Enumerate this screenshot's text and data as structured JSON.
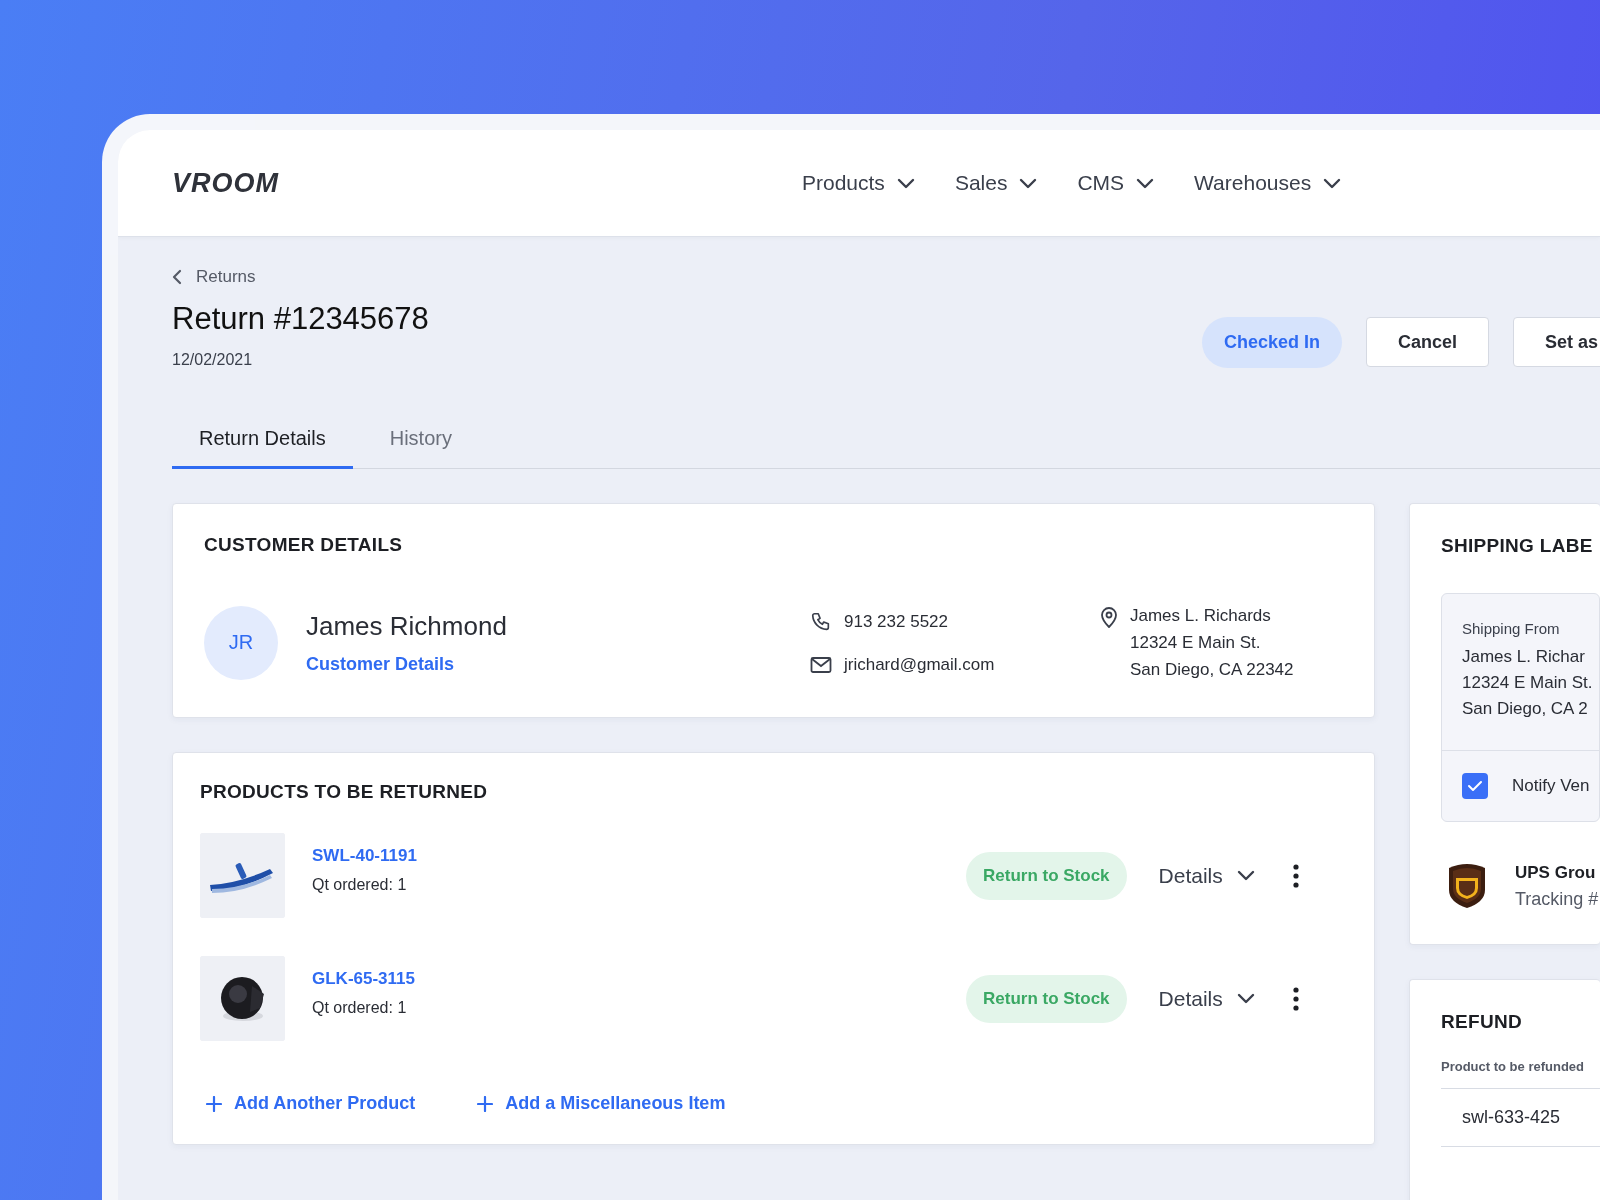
{
  "logo": "VROOM",
  "nav": [
    {
      "label": "Products"
    },
    {
      "label": "Sales"
    },
    {
      "label": "CMS"
    },
    {
      "label": "Warehouses"
    }
  ],
  "breadcrumb": "Returns",
  "title": "Return #12345678",
  "date": "12/02/2021",
  "status": "Checked In",
  "actions": [
    "Cancel",
    "Set as"
  ],
  "tabs": [
    {
      "label": "Return Details",
      "selected": true
    },
    {
      "label": "History",
      "selected": false
    }
  ],
  "customer_details": {
    "heading": "CUSTOMER DETAILS",
    "initials": "JR",
    "name": "James Richmond",
    "link": "Customer Details",
    "phone": "913 232 5522",
    "email": "jrichard@gmail.com",
    "address": [
      "James L. Richards",
      "12324 E Main St.",
      "San Diego, CA 22342"
    ]
  },
  "products": {
    "heading": "PRODUCTS TO BE RETURNED",
    "items": [
      {
        "sku": "SWL-40-1191",
        "quantity": "Qt ordered: 1",
        "status": "Return to Stock",
        "details": "Details"
      },
      {
        "sku": "GLK-65-3115",
        "quantity": "Qt ordered: 1",
        "status": "Return to Stock",
        "details": "Details"
      }
    ],
    "add_links": [
      "Add Another Product",
      "Add a Miscellaneous Item"
    ]
  },
  "shipping_label": {
    "heading": "SHIPPING LABE",
    "from_label": "Shipping From",
    "from_address": [
      "James L. Richar",
      "12324 E Main St.",
      "San Diego, CA 2"
    ],
    "notify": {
      "label": "Notify Ven",
      "checked": true
    },
    "carrier": {
      "name": "UPS Grou",
      "tracking": "Tracking #"
    }
  },
  "refund": {
    "heading": "REFUND",
    "label": "Product to be refunded",
    "items": [
      "swl-633-425"
    ]
  }
}
